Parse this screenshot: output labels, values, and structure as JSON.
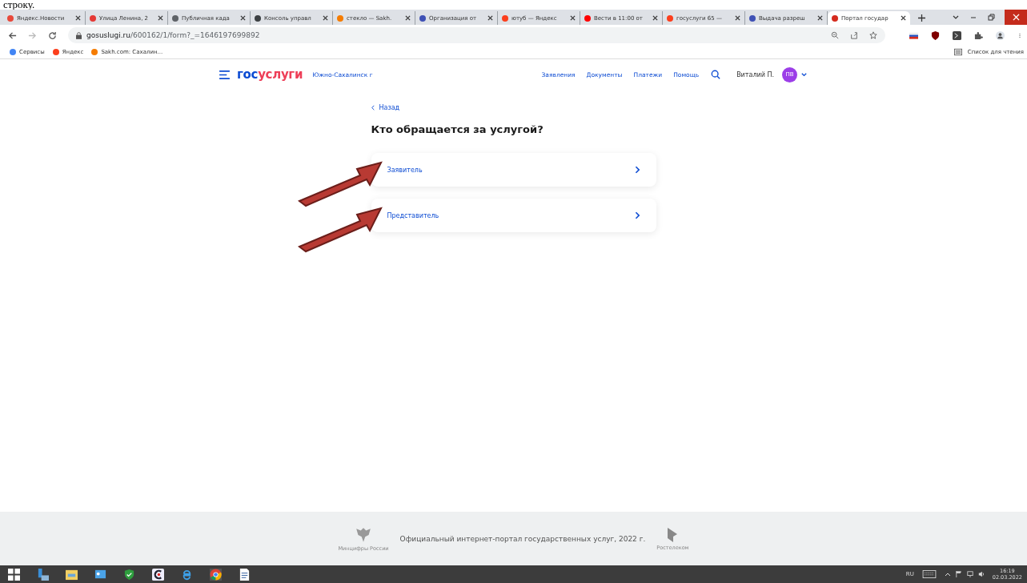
{
  "top_caption": "строку.",
  "tabs": [
    {
      "title": "Яндекс.Новости",
      "color": "#e8493b",
      "selected": false
    },
    {
      "title": "Улица Ленина, 2",
      "color": "#e53935",
      "selected": false
    },
    {
      "title": "Публичная када",
      "color": "#5f6368",
      "selected": false
    },
    {
      "title": "Консоль управл",
      "color": "#3c4043",
      "selected": false
    },
    {
      "title": "стекло — Sakh.",
      "color": "#f57c00",
      "selected": false
    },
    {
      "title": "Организация от",
      "color": "#3f51b5",
      "selected": false
    },
    {
      "title": "ютуб — Яндекс",
      "color": "#fc3f1d",
      "selected": false
    },
    {
      "title": "Вести в 11:00 от",
      "color": "#ff0000",
      "selected": false
    },
    {
      "title": "госуслуги 65 — ",
      "color": "#fc3f1d",
      "selected": false
    },
    {
      "title": "Выдача разреш",
      "color": "#3f51b5",
      "selected": false
    },
    {
      "title": "Портал государ",
      "color": "#d52b1e",
      "selected": true
    }
  ],
  "address": {
    "host": "gosuslugi.ru",
    "path": "/600162/1/form?_=1646197699892"
  },
  "bookmarks": [
    {
      "label": "Сервисы",
      "color": "#4285f4"
    },
    {
      "label": "Яндекс",
      "color": "#fc3f1d"
    },
    {
      "label": "Sakh.com: Сахалин...",
      "color": "#f57c00"
    }
  ],
  "reading_list": "Список для чтения",
  "header": {
    "logo": {
      "part_1": "гос",
      "part_2": "услуги"
    },
    "region": "Южно-Сахалинск г",
    "nav": [
      "Заявления",
      "Документы",
      "Платежи",
      "Помощь"
    ],
    "user_name": "Виталий П.",
    "avatar_initials": "ПВ"
  },
  "back_link": "Назад",
  "heading": "Кто обращается за услугой?",
  "options": [
    {
      "label": "Заявитель",
      "marked": true
    },
    {
      "label": "Представитель",
      "marked": true
    }
  ],
  "footer": {
    "emblem_caption": "Минцифры России",
    "text": "Официальный интернет-портал государственных услуг, 2022 г.",
    "partner_caption": "Ростелеком"
  },
  "tray": {
    "language": "RU",
    "time": "16:19",
    "date": "02.03.2022"
  }
}
